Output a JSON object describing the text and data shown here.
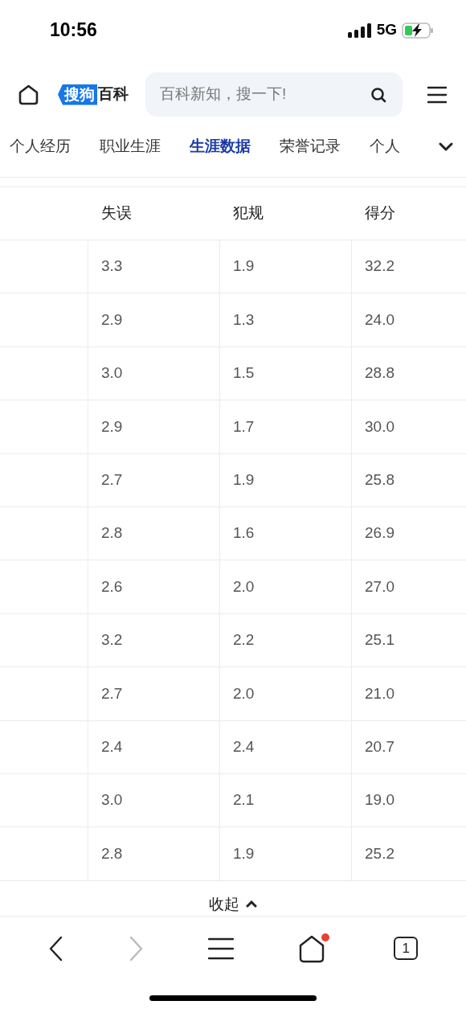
{
  "status_bar": {
    "time": "10:56",
    "network": "5G"
  },
  "header": {
    "logo": {
      "badge": "搜狗",
      "text": "百科"
    },
    "search": {
      "placeholder": "百科新知，搜一下!"
    }
  },
  "tabs": [
    {
      "label": "个人经历",
      "selected": false
    },
    {
      "label": "职业生涯",
      "selected": false
    },
    {
      "label": "生涯数据",
      "selected": true
    },
    {
      "label": "荣誉记录",
      "selected": false
    },
    {
      "label": "个人",
      "selected": false
    }
  ],
  "table": {
    "columns": [
      "失误",
      "犯规",
      "得分"
    ],
    "rows": [
      [
        "3.3",
        "1.9",
        "32.2"
      ],
      [
        "2.9",
        "1.3",
        "24.0"
      ],
      [
        "3.0",
        "1.5",
        "28.8"
      ],
      [
        "2.9",
        "1.7",
        "30.0"
      ],
      [
        "2.7",
        "1.9",
        "25.8"
      ],
      [
        "2.8",
        "1.6",
        "26.9"
      ],
      [
        "2.6",
        "2.0",
        "27.0"
      ],
      [
        "3.2",
        "2.2",
        "25.1"
      ],
      [
        "2.7",
        "2.0",
        "21.0"
      ],
      [
        "2.4",
        "2.4",
        "20.7"
      ],
      [
        "3.0",
        "2.1",
        "19.0"
      ],
      [
        "2.8",
        "1.9",
        "25.2"
      ]
    ]
  },
  "collapse": {
    "label": "收起"
  },
  "toolbar": {
    "back_disabled": false,
    "forward_disabled": true,
    "home_badge": true,
    "tab_count": "1"
  }
}
